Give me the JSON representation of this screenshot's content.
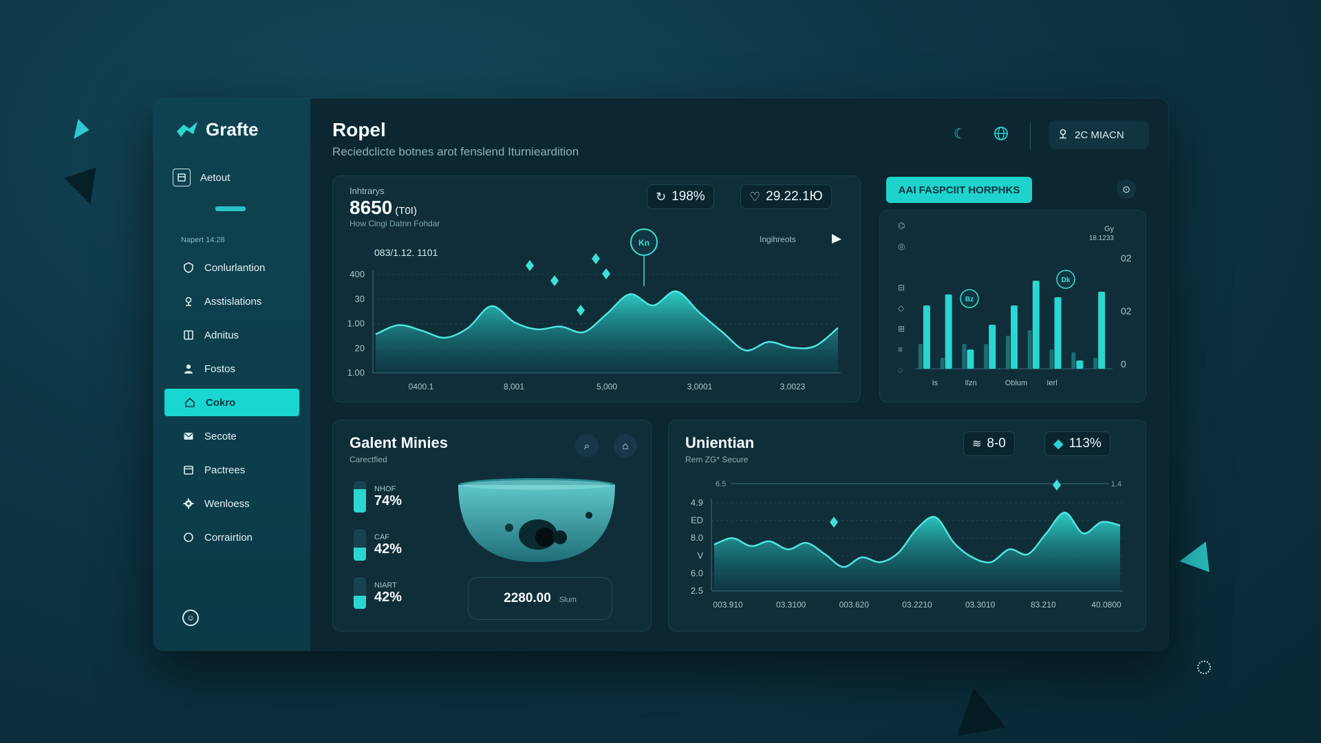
{
  "brand": {
    "name": "Grafte"
  },
  "sidebar": {
    "account_label": "Aetout",
    "section_label": "Napert 14:28",
    "items": [
      {
        "label": "Conlurlantion",
        "icon": "shield-icon",
        "active": false
      },
      {
        "label": "Asstislations",
        "icon": "location-pin-icon",
        "active": false
      },
      {
        "label": "Adnitus",
        "icon": "book-icon",
        "active": false
      },
      {
        "label": "Fostos",
        "icon": "user-icon",
        "active": false
      },
      {
        "label": "Cokro",
        "icon": "home-icon",
        "active": true
      },
      {
        "label": "Secote",
        "icon": "mail-icon",
        "active": false
      },
      {
        "label": "Pactrees",
        "icon": "calendar-icon",
        "active": false
      },
      {
        "label": "Wenloess",
        "icon": "gear-icon",
        "active": false
      },
      {
        "label": "Corrairtion",
        "icon": "circle-icon",
        "active": false
      }
    ]
  },
  "header": {
    "title": "Ropel",
    "subtitle": "Reciedclicte botnes arot fenslend Iturnieardition",
    "location": "2C MIACN"
  },
  "kpi": {
    "label": "Inhtrarys",
    "value": "8650",
    "unit": "(T0I)",
    "sub": "How Cingi Datnn Fohdar",
    "stat1": "198%",
    "stat2": "29.22.1Ю"
  },
  "chip": {
    "label": "AAI FASPCIIT HORPHKS"
  },
  "card_cam": {
    "title": "Galent Minies",
    "subtitle": "Carectfied",
    "value": "2280.00",
    "unit": "Slum",
    "gauges": [
      {
        "name": "NHOF",
        "value": "74%",
        "level": 0.74
      },
      {
        "name": "CAF",
        "value": "42%",
        "level": 0.42
      },
      {
        "name": "NIART",
        "value": "42%",
        "level": 0.42
      }
    ]
  },
  "card_line": {
    "title": "Unientian",
    "subtitle": "Rem ZG* Secure",
    "stat1": "8-0",
    "stat2": "113%"
  },
  "chart_data": [
    {
      "type": "area",
      "annotation": "083/1.12. 1101",
      "legend_note": "Ingihreots",
      "marker_label": "Kn",
      "y_tick_labels": [
        "400",
        "30",
        "1.00",
        "20",
        "1.00"
      ],
      "x_tick_labels": [
        "0400.1",
        "8,001",
        "5,000",
        "3,0001",
        "3,0023"
      ],
      "x": [
        0,
        1,
        2,
        3,
        4,
        5,
        6,
        7,
        8,
        9,
        10,
        11,
        12,
        13,
        14,
        15,
        16,
        17,
        18,
        19,
        20
      ],
      "values": [
        55,
        68,
        60,
        50,
        64,
        95,
        72,
        62,
        66,
        58,
        84,
        112,
        96,
        116,
        86,
        58,
        32,
        44,
        36,
        38,
        64
      ],
      "ylim": [
        0,
        140
      ]
    },
    {
      "type": "bar",
      "right_tick_labels": [
        "02",
        "02",
        "0"
      ],
      "x_tick_labels": [
        "Is",
        "Ilzn",
        "Oblum",
        "Ierl"
      ],
      "top_label": "Gy",
      "top_sub": "18.1233",
      "badges": [
        "Bz",
        "Dk"
      ],
      "series": [
        {
          "values": [
            2.3,
            2.7,
            0.7,
            1.6,
            2.3,
            3.2,
            2.6,
            0.3,
            2.8
          ]
        },
        {
          "values": [
            0.9,
            0.4,
            0.9,
            0.9,
            1.2,
            1.4,
            0.7,
            0.6,
            0.4
          ]
        }
      ],
      "ylim": [
        0,
        4
      ]
    },
    {
      "type": "area",
      "y_tick_labels": [
        "4.9",
        "ED",
        "8.0",
        "V",
        "6.0",
        "2.5"
      ],
      "x_tick_labels": [
        "003.910",
        "03.3100",
        "003.620",
        "03.2210",
        "03.3010",
        "83.210",
        "40.0800"
      ],
      "top_left_label": "6.5",
      "top_right_label": "1.4",
      "x": [
        0,
        1,
        2,
        3,
        4,
        5,
        6,
        7,
        8,
        9,
        10,
        11,
        12,
        13,
        14,
        15,
        16,
        17,
        18,
        19,
        20,
        21,
        22
      ],
      "values": [
        58,
        66,
        56,
        62,
        52,
        60,
        46,
        30,
        42,
        36,
        48,
        78,
        92,
        60,
        42,
        36,
        52,
        46,
        72,
        98,
        72,
        86,
        82
      ],
      "ylim": [
        0,
        110
      ]
    }
  ],
  "colors": {
    "accent": "#1fd3cd",
    "bg": "#0c2732",
    "sidebar": "#0f4250",
    "card": "#0f2e39"
  }
}
